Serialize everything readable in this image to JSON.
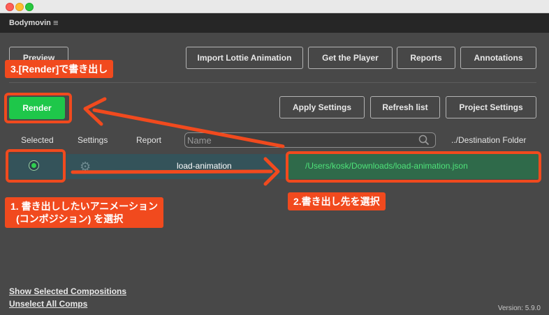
{
  "panel": {
    "title": "Bodymovin",
    "menu_glyph": "≡"
  },
  "toolbar": {
    "preview_label": "Preview",
    "import_label": "Import Lottie Animation",
    "player_label": "Get the Player",
    "reports_label": "Reports",
    "annotations_label": "Annotations",
    "render_label": "Render",
    "apply_label": "Apply Settings",
    "refresh_label": "Refresh list",
    "project_label": "Project Settings"
  },
  "columns": {
    "selected": "Selected",
    "settings": "Settings",
    "report": "Report",
    "destination": "../Destination Folder"
  },
  "search": {
    "placeholder": "Name",
    "icon": "search-icon"
  },
  "composition": {
    "name": "load-animation",
    "destination": "/Users/kosk/Downloads/load-animation.json",
    "selected": true,
    "settings_icon": "gear-icon"
  },
  "footer": {
    "show_selected": "Show Selected Compositions",
    "unselect_all": "Unselect All Comps",
    "version": "Version: 5.9.0"
  },
  "annotations": {
    "step1_line1": "1. 書き出ししたいアニメーション",
    "step1_line2": "(コンポジション) を選択",
    "step2": "2.書き出し先を選択",
    "step3": "3.[Render]で書き出し"
  },
  "colors": {
    "accent_annotation": "#f14a1e",
    "render_button": "#1ec74a",
    "destination_text": "#4fe27a",
    "selected_row": "#34535a"
  }
}
